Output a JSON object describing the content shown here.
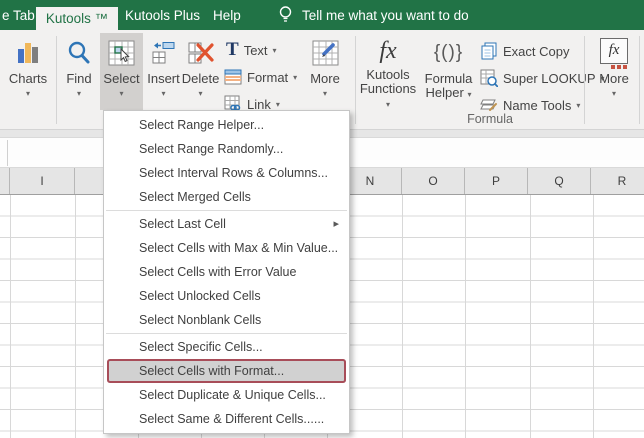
{
  "titlebar": {
    "partial_tab": "e Tab",
    "tabs": [
      {
        "label": "Kutools ™",
        "active": true
      },
      {
        "label": "Kutools Plus",
        "active": false
      },
      {
        "label": "Help",
        "active": false
      }
    ],
    "tell_me": "Tell me what you want to do"
  },
  "ribbon": {
    "buttons": {
      "charts": "Charts",
      "find": "Find",
      "select": "Select",
      "insert": "Insert",
      "delete": "Delete",
      "text": "Text",
      "format": "Format",
      "link": "Link",
      "more_editing": "More",
      "kutools_functions": [
        "Kutools",
        "Functions"
      ],
      "formula_helper": [
        "Formula",
        "Helper"
      ],
      "exact_copy": "Exact Copy",
      "super_lookup": "Super LOOKUP",
      "name_tools": "Name Tools",
      "more_formula": "More",
      "fx_glyph": "fx",
      "braces_glyph": "{()}"
    },
    "group_label": "Formula",
    "selected_button": "Select"
  },
  "select_menu": {
    "items": [
      {
        "label": "Select Range Helper...",
        "separator_after": false,
        "submenu": false,
        "highlighted": false
      },
      {
        "label": "Select Range Randomly...",
        "separator_after": false,
        "submenu": false,
        "highlighted": false
      },
      {
        "label": "Select Interval Rows & Columns...",
        "separator_after": false,
        "submenu": false,
        "highlighted": false
      },
      {
        "label": "Select Merged Cells",
        "separator_after": true,
        "submenu": false,
        "highlighted": false
      },
      {
        "label": "Select Last Cell",
        "separator_after": false,
        "submenu": true,
        "highlighted": false
      },
      {
        "label": "Select Cells with Max & Min Value...",
        "separator_after": false,
        "submenu": false,
        "highlighted": false
      },
      {
        "label": "Select Cells with Error Value",
        "separator_after": false,
        "submenu": false,
        "highlighted": false
      },
      {
        "label": "Select Unlocked Cells",
        "separator_after": false,
        "submenu": false,
        "highlighted": false
      },
      {
        "label": "Select Nonblank Cells",
        "separator_after": true,
        "submenu": false,
        "highlighted": false
      },
      {
        "label": "Select Specific Cells...",
        "separator_after": false,
        "submenu": false,
        "highlighted": false
      },
      {
        "label": "Select Cells with Format...",
        "separator_after": false,
        "submenu": false,
        "highlighted": true
      },
      {
        "label": "Select Duplicate & Unique Cells...",
        "separator_after": false,
        "submenu": false,
        "highlighted": false
      },
      {
        "label": "Select Same & Different Cells......",
        "separator_after": false,
        "submenu": false,
        "highlighted": false
      }
    ]
  },
  "worksheet": {
    "visible_columns_left": [
      "I"
    ],
    "visible_columns_right": [
      "N",
      "O",
      "P",
      "Q",
      "R"
    ]
  },
  "colors": {
    "excel_green": "#217346",
    "highlight_box_border": "#a84d59",
    "menu_highlight_bg": "#d1d1d1",
    "pressed_button_bg": "#d2d0ce"
  }
}
